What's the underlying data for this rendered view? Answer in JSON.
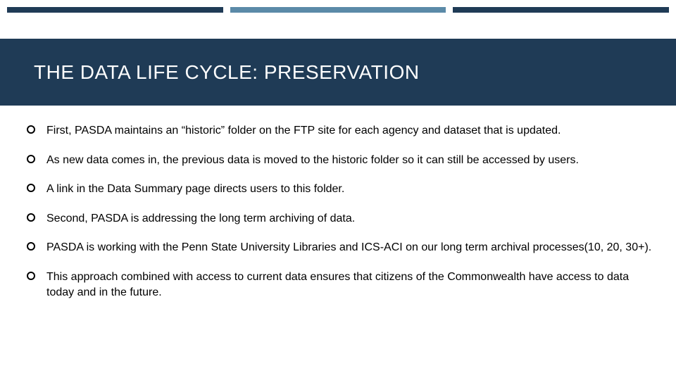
{
  "title": "THE DATA LIFE CYCLE: PRESERVATION",
  "bullets": [
    "First, PASDA maintains an “historic” folder on the FTP site for each agency and dataset that is updated.",
    "As new data comes in, the previous data is moved to the historic folder so it can still be accessed by users.",
    "A link in the Data Summary page directs users to this folder.",
    "Second, PASDA is addressing the long term archiving of data.",
    "PASDA is working with the Penn State University Libraries and ICS-ACI on our long term archival processes(10, 20, 30+).",
    "This approach combined with access to current data ensures that citizens of the Commonwealth have access to data today and in the future."
  ],
  "accent_colors": {
    "dark": "#1f3b56",
    "light": "#5b8aa8"
  }
}
